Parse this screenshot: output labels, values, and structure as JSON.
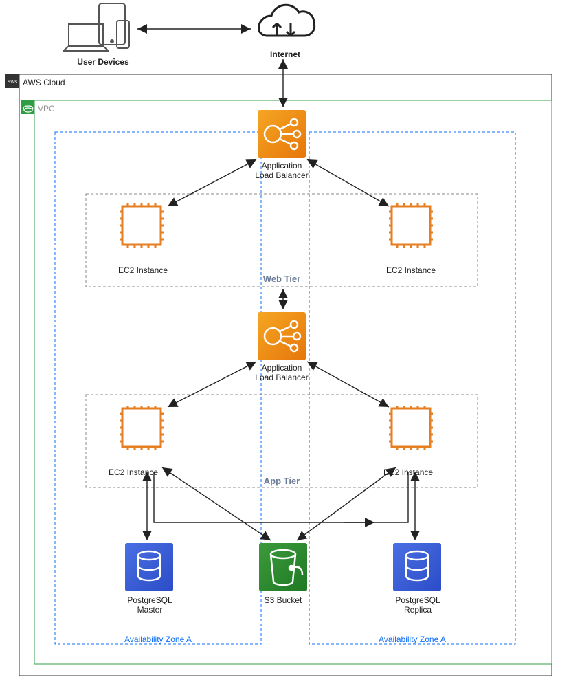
{
  "top": {
    "user_devices": "User Devices",
    "internet": "Internet"
  },
  "aws_cloud": "AWS Cloud",
  "vpc": "VPC",
  "az_left": "Availability Zone A",
  "az_right": "Availability Zone A",
  "alb1": "Application\nLoad Balancer",
  "alb2": "Application\nLoad Balancer",
  "web_tier": "Web Tier",
  "app_tier": "App Tier",
  "ec2_web_left": "EC2 Instance",
  "ec2_web_right": "EC2 Instance",
  "ec2_app_left": "EC2 Instance",
  "ec2_app_right": "EC2 Instance",
  "pg_master": "PostgreSQL\nMaster",
  "pg_replica": "PostgreSQL\nReplica",
  "s3_bucket": "S3 Bucket"
}
